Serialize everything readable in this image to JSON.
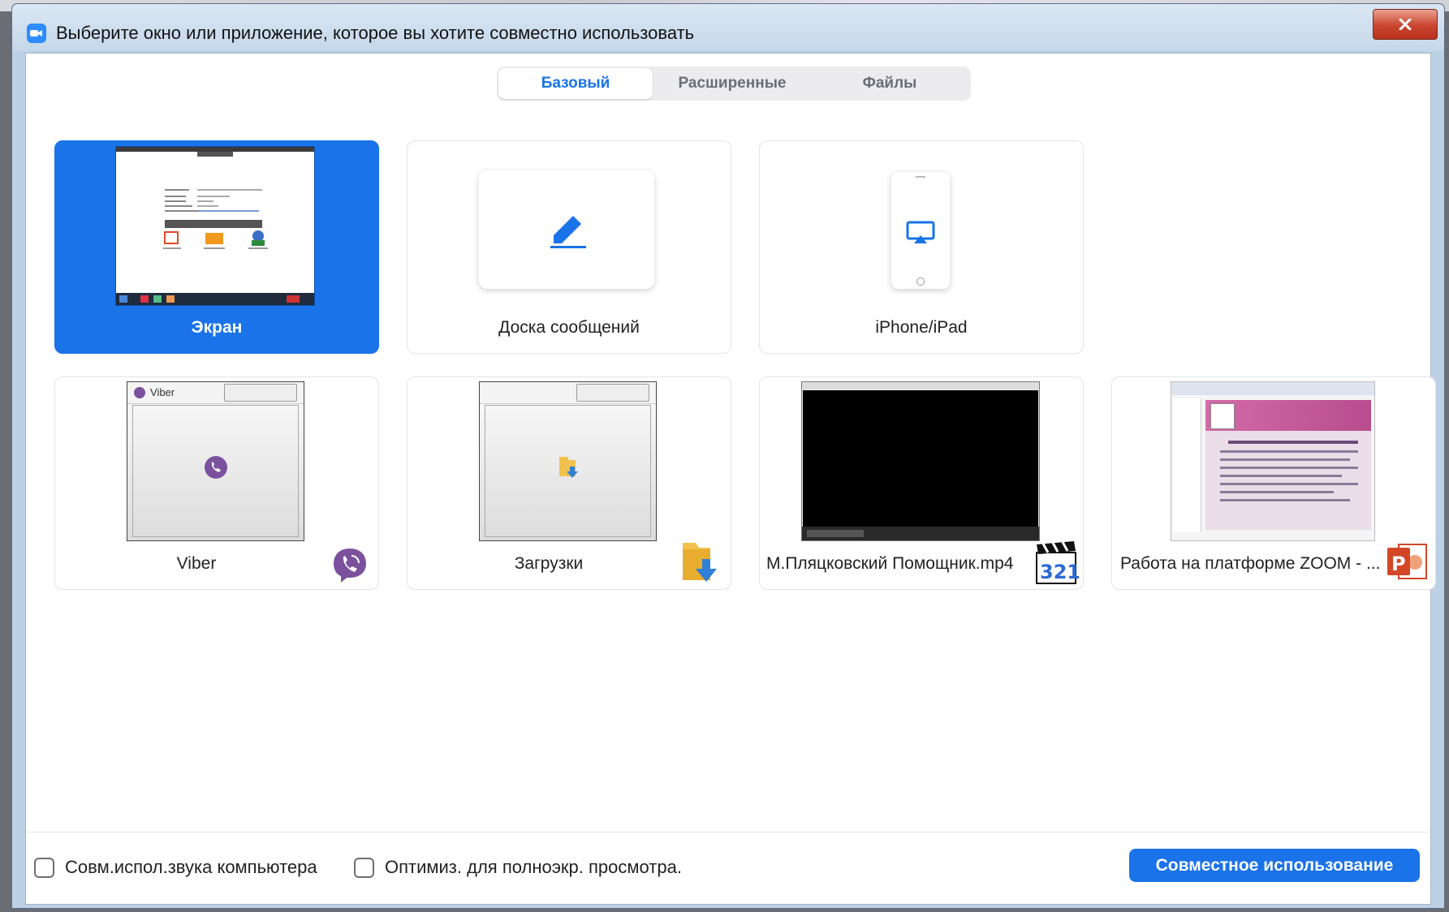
{
  "window": {
    "title": "Выберите окно или приложение, которое вы хотите совместно использовать"
  },
  "tabs": [
    {
      "label": "Базовый",
      "active": true
    },
    {
      "label": "Расширенные",
      "active": false
    },
    {
      "label": "Файлы",
      "active": false
    }
  ],
  "tiles": {
    "screen": {
      "label": "Экран",
      "selected": true
    },
    "whiteboard": {
      "label": "Доска сообщений"
    },
    "iphone": {
      "label": "iPhone/iPad"
    },
    "viber": {
      "label": "Viber",
      "window_title": "Viber"
    },
    "downloads": {
      "label": "Загрузки"
    },
    "video": {
      "label": "М.Пляцковский Помощник.mp4"
    },
    "presentation": {
      "label": "Работа на платформе ZOOM - ..."
    }
  },
  "footer": {
    "share_audio_label": "Совм.испол.звука компьютера",
    "optimize_label": "Оптимиз. для полноэкр. просмотра.",
    "share_button": "Совместное использование"
  },
  "colors": {
    "accent": "#1a73e8",
    "viber": "#7b519d",
    "powerpoint": "#d24726"
  }
}
